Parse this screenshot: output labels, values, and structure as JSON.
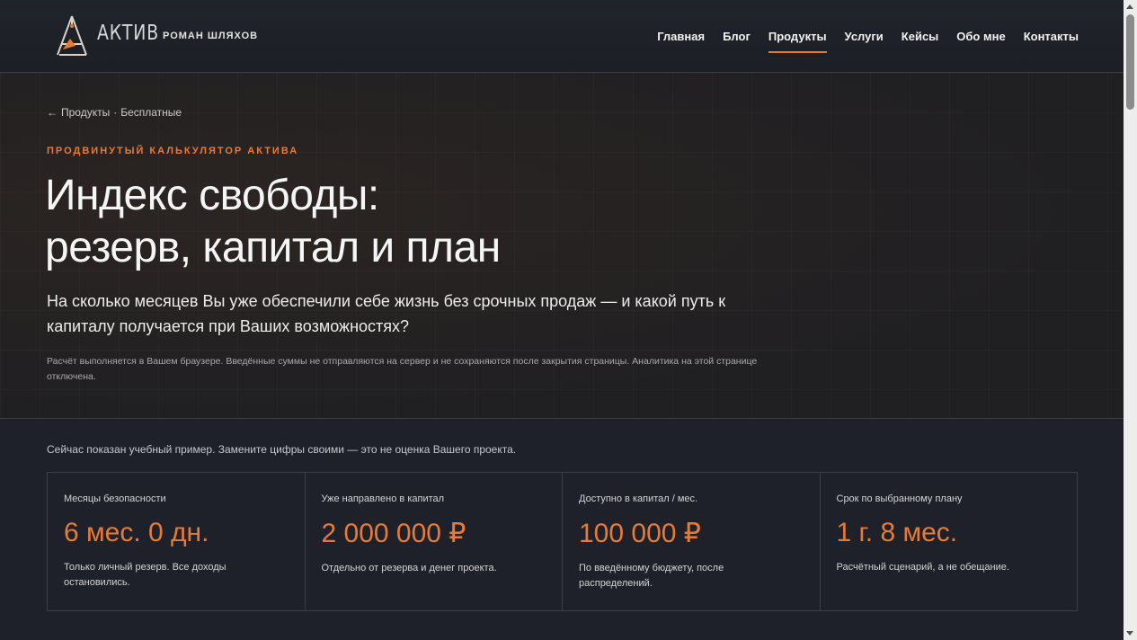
{
  "header": {
    "logo_text": "АКТИВ",
    "brand_name": "РОМАН ШЛЯХОВ",
    "nav": [
      {
        "label": "Главная",
        "active": false
      },
      {
        "label": "Блог",
        "active": false
      },
      {
        "label": "Продукты",
        "active": true
      },
      {
        "label": "Услуги",
        "active": false
      },
      {
        "label": "Кейсы",
        "active": false
      },
      {
        "label": "Обо мне",
        "active": false
      },
      {
        "label": "Контакты",
        "active": false
      }
    ]
  },
  "hero": {
    "breadcrumb": {
      "arrow": "←",
      "parent": "Продукты",
      "separator": "·",
      "current": "Бесплатные"
    },
    "eyebrow": "ПРОДВИНУТЫЙ КАЛЬКУЛЯТОР АКТИВА",
    "title_line1": "Индекс свободы:",
    "title_line2": "резерв, капитал и план",
    "lead": "На сколько месяцев Вы уже обеспечили себе жизнь без срочных продаж — и какой путь к капиталу получается при Ваших возможностях?",
    "note": "Расчёт выполняется в Вашем браузере. Введённые суммы не отправляются на сервер и не сохраняются после закрытия страницы. Аналитика на этой странице отключена."
  },
  "summary": {
    "sample_note": "Сейчас показан учебный пример. Замените цифры своими — это не оценка Вашего проекта.",
    "cards": [
      {
        "label": "Месяцы безопасности",
        "value": "6 мес. 0 дн.",
        "desc": "Только личный резерв. Все доходы остановились."
      },
      {
        "label": "Уже направлено в капитал",
        "value": "2 000 000 ₽",
        "desc": "Отдельно от резерва и денег проекта."
      },
      {
        "label": "Доступно в капитал / мес.",
        "value": "100 000 ₽",
        "desc": "По введённому бюджету, после распределений."
      },
      {
        "label": "Срок по выбранному плану",
        "value": "1 г. 8 мес.",
        "desc": "Расчётный сценарий, а не обещание."
      }
    ]
  },
  "colors": {
    "accent": "#e77b35",
    "background": "#1e2129"
  }
}
